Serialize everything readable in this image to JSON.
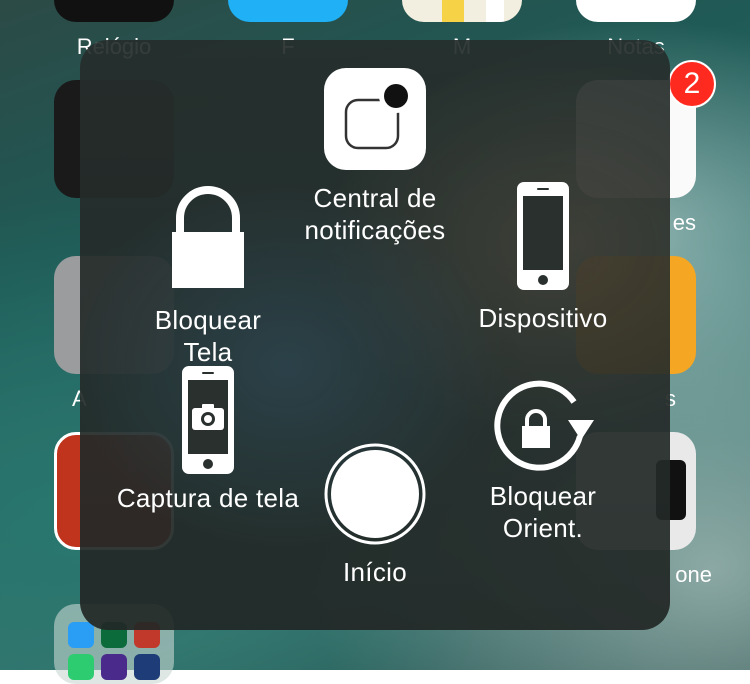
{
  "home_screen": {
    "labels": [
      "Relógio",
      "F",
      "M",
      "Notas",
      "es",
      "A",
      "s",
      "one"
    ],
    "badge_count": "2"
  },
  "assistive_touch": {
    "notification_center": {
      "line1": "Central de",
      "line2": "notificações",
      "icon": "notification-center-icon"
    },
    "lock_screen": {
      "line1": "Bloquear",
      "line2": "Tela",
      "icon": "padlock-icon"
    },
    "device": {
      "label": "Dispositivo",
      "icon": "iphone-icon"
    },
    "screenshot": {
      "label": "Captura de tela",
      "icon": "camera-phone-icon"
    },
    "home": {
      "label": "Início",
      "icon": "home-button-icon"
    },
    "lock_rotation": {
      "line1": "Bloquear",
      "line2": "Orient.",
      "icon": "rotation-lock-icon"
    }
  }
}
